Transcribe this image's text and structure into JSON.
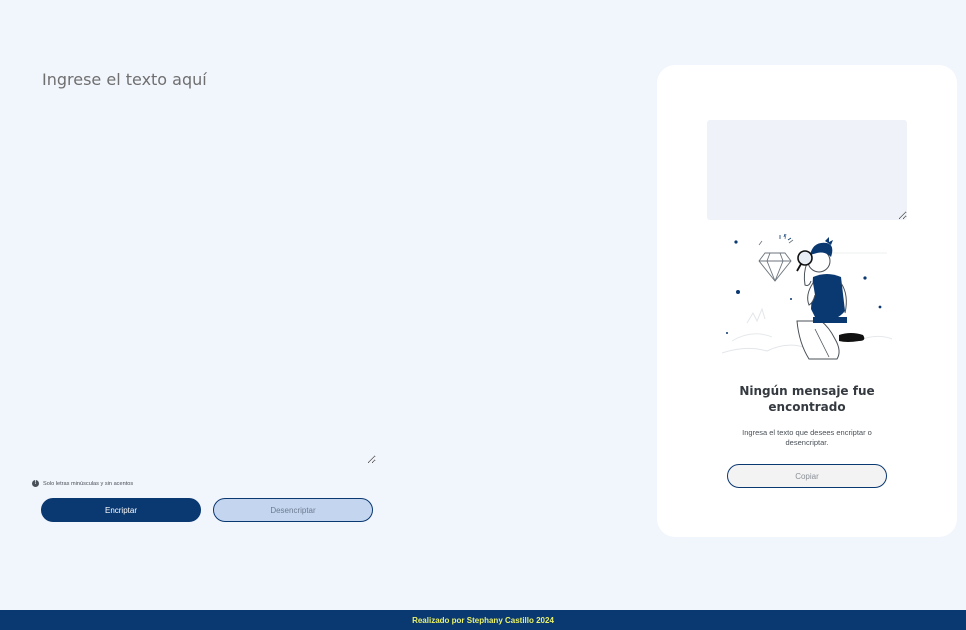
{
  "input": {
    "placeholder": "Ingrese el texto aquí",
    "value": ""
  },
  "hint": {
    "icon": "info-icon",
    "icon_glyph": "!",
    "text": "Solo letras minúsculas y sin acentos"
  },
  "buttons": {
    "encrypt_label": "Encriptar",
    "decrypt_label": "Desencriptar"
  },
  "output_panel": {
    "output_value": "",
    "illustration": "person-with-magnifying-glass-illustration",
    "empty_title": "Ningún mensaje fue encontrado",
    "empty_description": "Ingresa el texto que desees encriptar o desencriptar.",
    "copy_label": "Copiar"
  },
  "footer": {
    "text": "Realizado por Stephany Castillo 2024"
  },
  "colors": {
    "background": "#F1F5FC",
    "primary": "#0A3871",
    "secondary_button": "#C4D6EF",
    "footer_text": "#E9F26A",
    "panel": "#FFFFFF"
  }
}
